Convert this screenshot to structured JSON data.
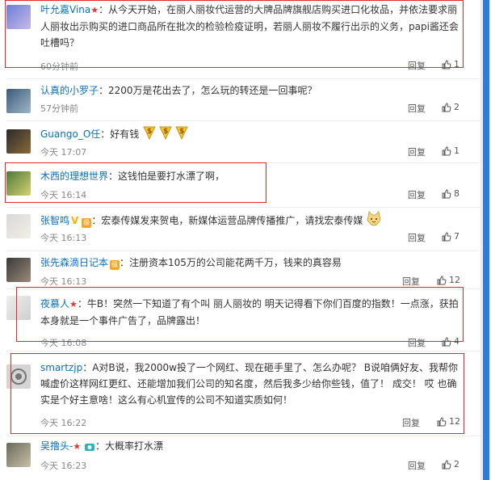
{
  "reply_label": "回复",
  "comments": [
    {
      "name": "叶允嘉Vina",
      "text": "：从今天开始，在丽人丽妆代运营的大牌品牌旗舰店购买进口化妆品，并依法要求丽人丽妆出示购买的进口商品所在批次的检验检疫证明，若丽人丽妆不履行出示的义务，papi酱还会吐槽吗？",
      "time": "60分钟前",
      "likes": "1"
    },
    {
      "name": "认真的小罗子",
      "text": "：2200万是花出去了，怎么玩的转还是一回事呢？",
      "time": "57分钟前",
      "likes": "2"
    },
    {
      "name": "Guango_O任",
      "text": "：好有钱",
      "time": "今天 17:07",
      "likes": "1"
    },
    {
      "name": "木西的理想世界",
      "text": "：这钱怕是要打水漂了啊，",
      "time": "今天 16:14",
      "likes": "8"
    },
    {
      "name": "张智鸣",
      "text": "：宏泰传媒发来贺电，新媒体运营品牌传播推广，请找宏泰传媒",
      "time": "今天 16:13",
      "likes": "7"
    },
    {
      "name": "张先森滴日记本",
      "text": "：注册资本105万的公司能花两千万，钱来的真容易",
      "time": "今天 16:13",
      "likes": "12"
    },
    {
      "name": "夜慕人",
      "text": "：牛B！突然一下知道了有个叫 丽人丽妆的  明天记得看下你们百度的指数！一点涨，获拍本身就是一个事件广告了，品牌露出！",
      "time": "今天 16:08",
      "likes": "4"
    },
    {
      "name": "smartzjp",
      "text": "：A对B说，我2000w投了一个网红、现在砸手里了、怎么办呢？ B说咱俩好友、我帮你喊虚价这样网红更红、还能增加我们公司的知名度，然后我多少给你些钱，值了！ 成交！ 哎 也确实是个好主意啥！这么有心机宣传的公司不知道实质如何！",
      "time": "今天 16:22",
      "likes": "12"
    },
    {
      "name": "吴撸头-",
      "text": "：大概率打水漂",
      "time": "今天 16:23",
      "likes": "2"
    }
  ]
}
